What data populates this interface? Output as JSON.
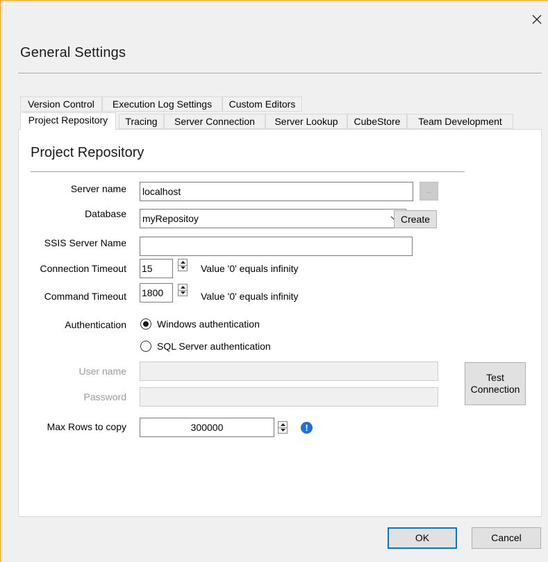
{
  "window": {
    "title": "General Settings",
    "close_icon": "close-icon"
  },
  "tabs_row1": [
    {
      "label": "Version Control"
    },
    {
      "label": "Execution Log Settings"
    },
    {
      "label": "Custom Editors"
    }
  ],
  "tabs_row2": [
    {
      "label": "Project Repository",
      "active": true
    },
    {
      "label": "Tracing"
    },
    {
      "label": "Server Connection"
    },
    {
      "label": "Server Lookup"
    },
    {
      "label": "CubeStore"
    },
    {
      "label": "Team Development"
    }
  ],
  "panel": {
    "title": "Project Repository",
    "server_name": {
      "label": "Server name",
      "value": "localhost",
      "browse_label": ".."
    },
    "database": {
      "label": "Database",
      "value": "myRepositoy",
      "create_label": "Create"
    },
    "ssis_server": {
      "label": "SSIS Server Name",
      "value": ""
    },
    "connection_timeout": {
      "label": "Connection Timeout",
      "value": "15",
      "hint": "Value '0' equals infinity"
    },
    "command_timeout": {
      "label": "Command Timeout",
      "value": "1800",
      "hint": "Value '0' equals infinity"
    },
    "authentication": {
      "label": "Authentication",
      "options": [
        {
          "label": "Windows authentication",
          "checked": true
        },
        {
          "label": "SQL Server authentication",
          "checked": false
        }
      ]
    },
    "user_name": {
      "label": "User name",
      "value": ""
    },
    "password": {
      "label": "Password",
      "value": ""
    },
    "test_connection_label": "Test Connection",
    "max_rows": {
      "label": "Max Rows to copy",
      "value": "300000",
      "info_icon": "info-icon"
    }
  },
  "footer": {
    "ok_label": "OK",
    "cancel_label": "Cancel"
  },
  "colors": {
    "accent": "#0078d7",
    "info": "#1e6fd9",
    "panel_bg": "#ffffff",
    "window_bg": "#f0f0f0"
  }
}
